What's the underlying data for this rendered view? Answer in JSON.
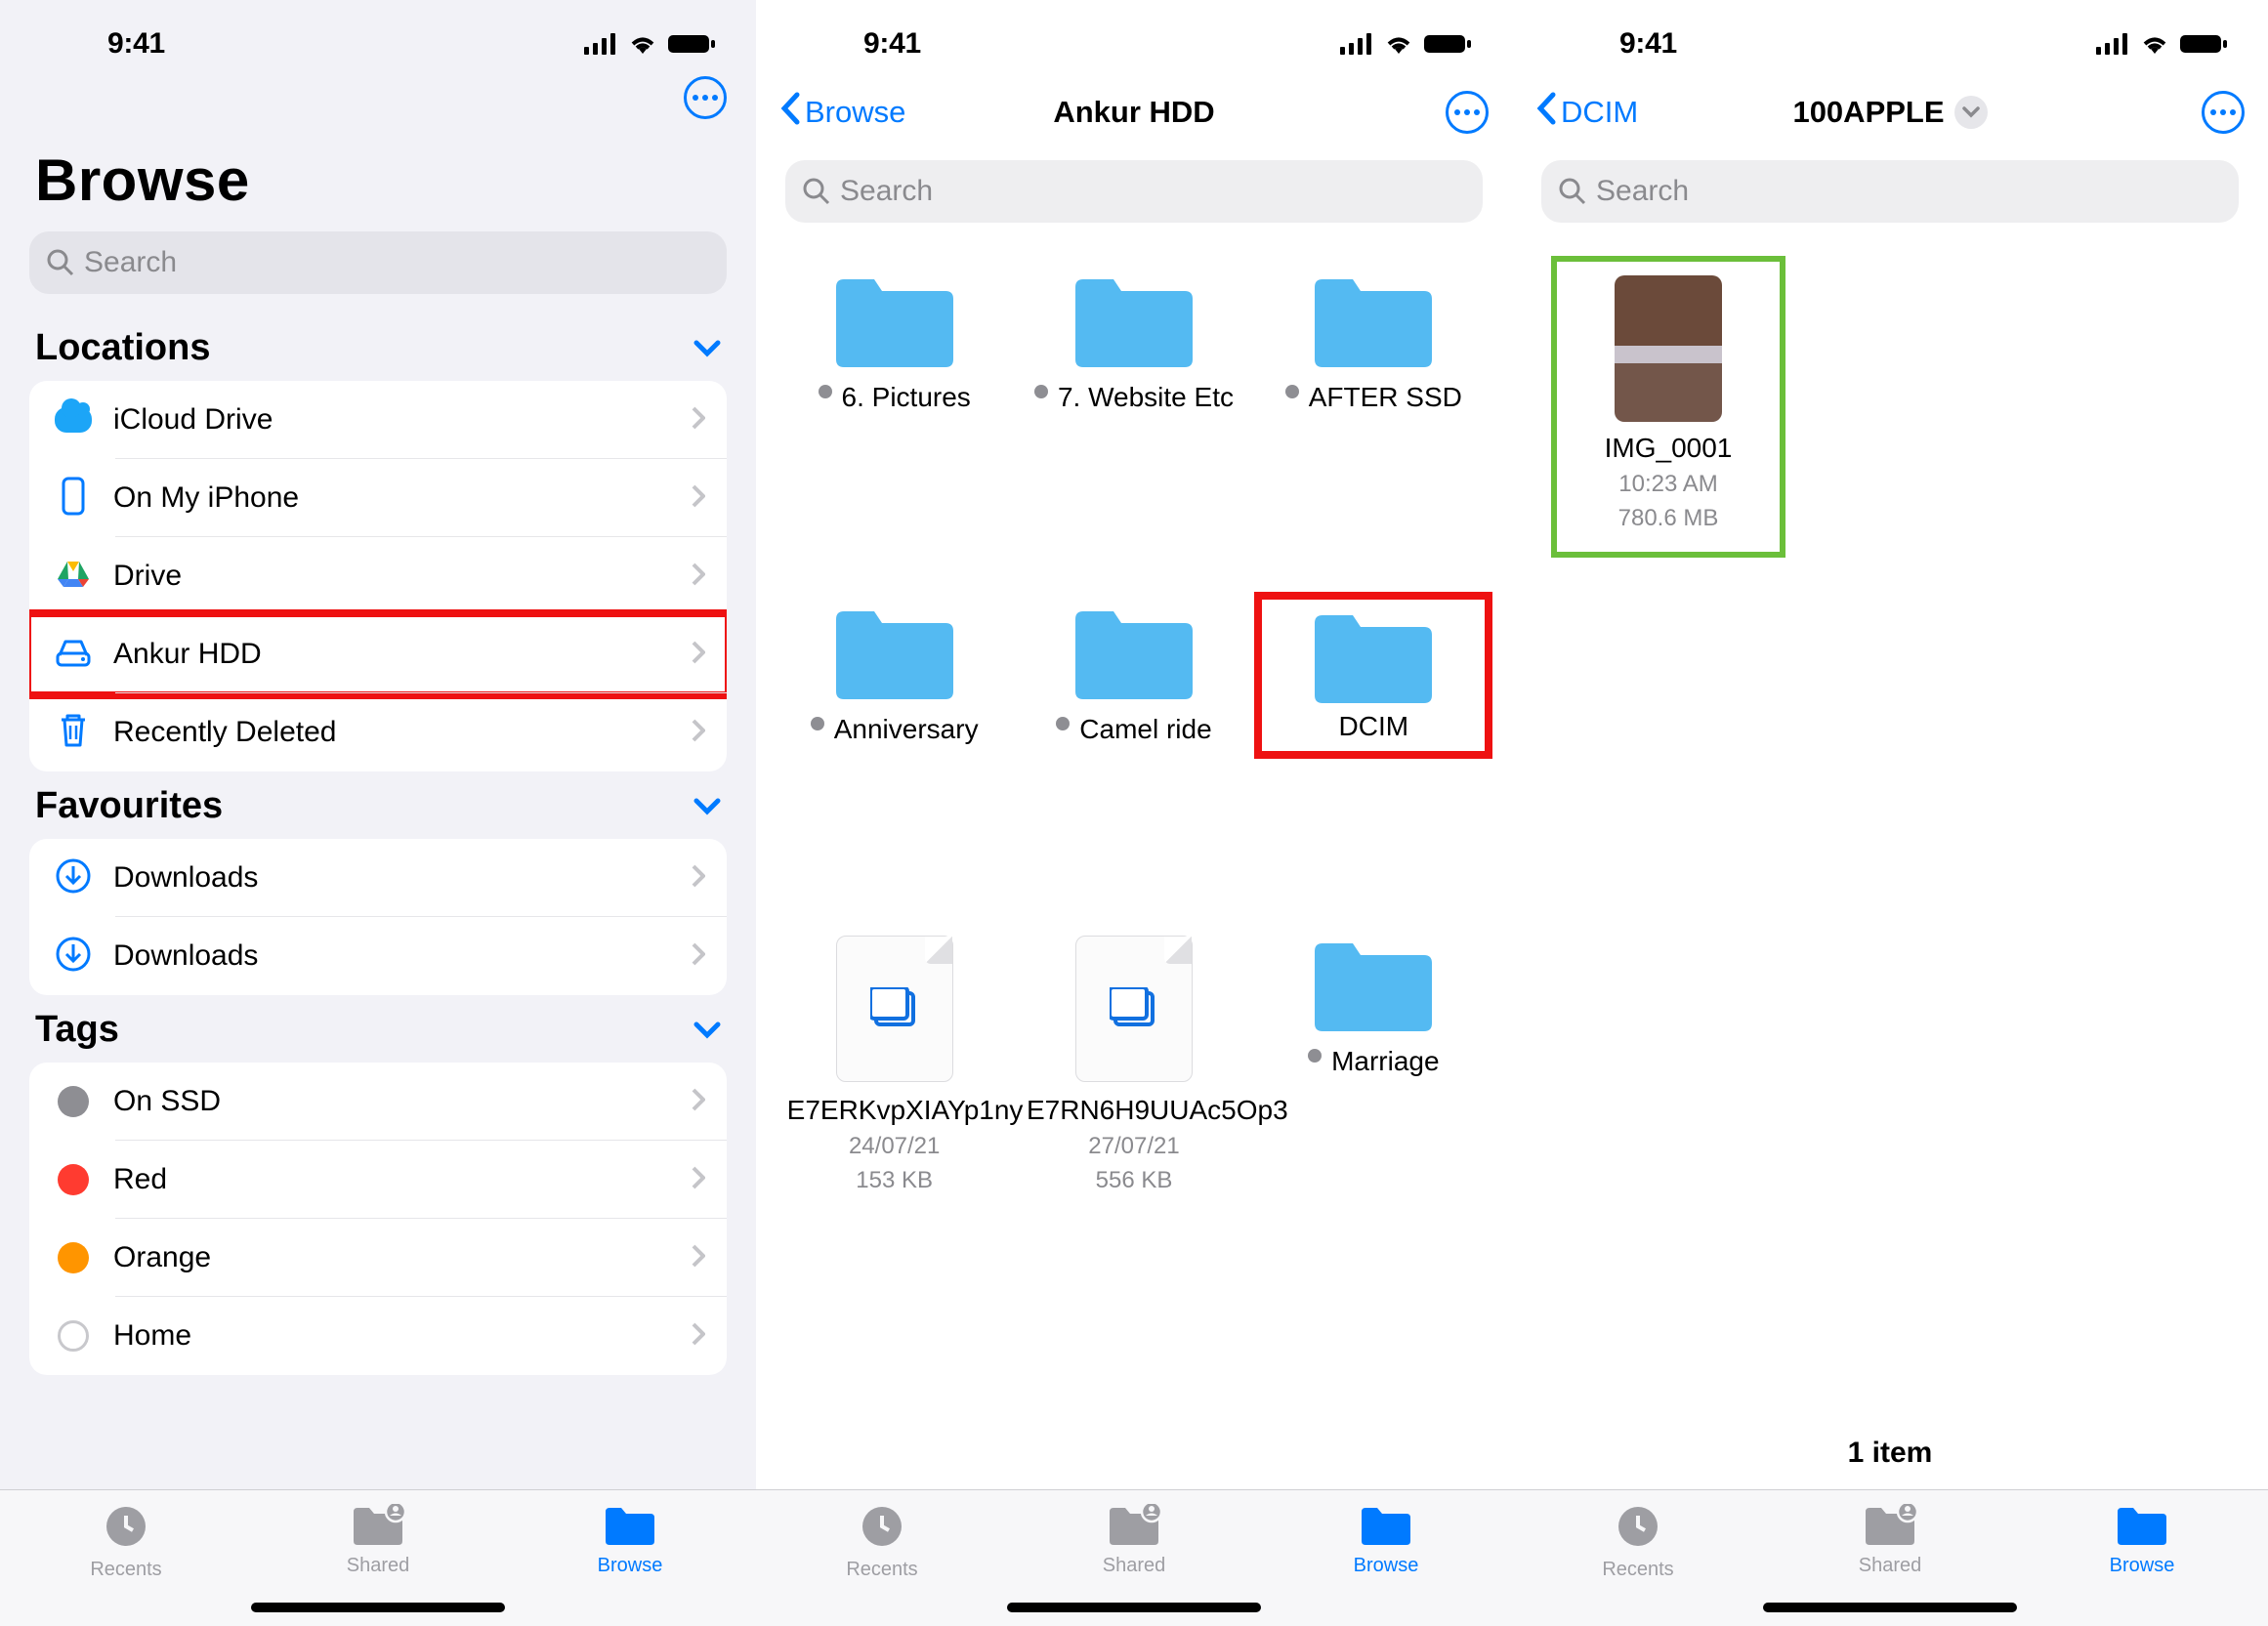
{
  "status": {
    "time": "9:41"
  },
  "search": {
    "placeholder": "Search"
  },
  "tabbar": {
    "recents": "Recents",
    "shared": "Shared",
    "browse": "Browse"
  },
  "phone1": {
    "title": "Browse",
    "sections": {
      "locations": "Locations",
      "favourites": "Favourites",
      "tags": "Tags"
    },
    "locations": [
      {
        "label": "iCloud Drive"
      },
      {
        "label": "On My iPhone"
      },
      {
        "label": "Drive"
      },
      {
        "label": "Ankur HDD"
      },
      {
        "label": "Recently Deleted"
      }
    ],
    "favourites": [
      {
        "label": "Downloads"
      },
      {
        "label": "Downloads"
      }
    ],
    "tags": [
      {
        "label": "On SSD",
        "color": "#8e8e93"
      },
      {
        "label": "Red",
        "color": "#ff3b30"
      },
      {
        "label": "Orange",
        "color": "#ff9500"
      },
      {
        "label": "Home",
        "color": ""
      }
    ]
  },
  "phone2": {
    "back": "Browse",
    "title": "Ankur HDD",
    "items": [
      {
        "type": "folder",
        "name": "6. Pictures",
        "dot": true
      },
      {
        "type": "folder",
        "name": "7. Website Etc",
        "dot": true
      },
      {
        "type": "folder",
        "name": "AFTER SSD",
        "dot": true
      },
      {
        "type": "folder",
        "name": "Anniversary",
        "dot": true
      },
      {
        "type": "folder",
        "name": "Camel ride",
        "dot": true
      },
      {
        "type": "folder",
        "name": "DCIM",
        "dot": false,
        "highlight": true
      },
      {
        "type": "file",
        "name": "E7ERKvpXIAYp1ny",
        "date": "24/07/21",
        "size": "153 KB"
      },
      {
        "type": "file",
        "name": "E7RN6H9UUAc5Op3",
        "date": "27/07/21",
        "size": "556 KB"
      },
      {
        "type": "folder",
        "name": "Marriage",
        "dot": true
      }
    ]
  },
  "phone3": {
    "back": "DCIM",
    "title": "100APPLE",
    "file": {
      "name": "IMG_0001",
      "time": "10:23 AM",
      "size": "780.6 MB"
    },
    "count": "1 item"
  }
}
